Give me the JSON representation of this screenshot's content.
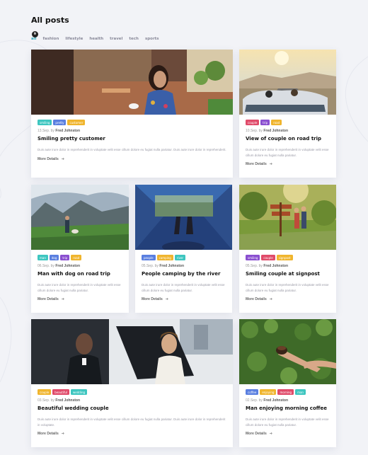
{
  "page": {
    "title": "All posts"
  },
  "filters": [
    {
      "label": "all",
      "active": true,
      "count": "9"
    },
    {
      "label": "fashion"
    },
    {
      "label": "lifestyle"
    },
    {
      "label": "health"
    },
    {
      "label": "travel"
    },
    {
      "label": "tech"
    },
    {
      "label": "sports"
    }
  ],
  "tag_colors": {
    "smiling": "#3ec6c0",
    "pretty": "#5a7fe0",
    "customer": "#f0b52e",
    "couple": "#e04b6a",
    "trip": "#8a4fd0",
    "road": "#f0b52e",
    "man": "#3ec6c0",
    "dog": "#5a7fe0",
    "people": "#5a7fe0",
    "river": "#3ec6c0",
    "signpost": "#f0b52e",
    "beautiful": "#e04b6a",
    "wedding": "#3ec6c0",
    "coffee": "#5a7fe0",
    "enjoying": "#f0b52e",
    "morning": "#e04b6a",
    "man2": "#3ec6c0"
  },
  "cards": [
    {
      "id": "smiling-customer",
      "tags": [
        {
          "label": "smiling",
          "color": "#3ec6c0"
        },
        {
          "label": "pretty",
          "color": "#5a7fe0"
        },
        {
          "label": "customer",
          "color": "#f0b52e"
        }
      ],
      "date": "13.Sep.",
      "by": "by",
      "author": "Fred Johnston",
      "title": "Smiling pretty customer",
      "excerpt": "Duis aute irure dolor in reprehenderit in voluptate velit esse cillum dolore eu fugiat nulla pariatur. Duis aute irure dolor in reprehenderit.",
      "more": "More Details"
    },
    {
      "id": "couple-road-trip",
      "tags": [
        {
          "label": "couple",
          "color": "#e04b6a"
        },
        {
          "label": "trip",
          "color": "#8a4fd0"
        },
        {
          "label": "road",
          "color": "#f0b52e"
        }
      ],
      "date": "10.Sep.",
      "by": "by",
      "author": "Fred Johnston",
      "title": "View of couple on road trip",
      "excerpt": "Duis aute irure dolor in reprehenderit in voluptate velit esse cillum dolore eu fugiat nulla pariatur.",
      "more": "More Details"
    },
    {
      "id": "man-dog-road-trip",
      "tags": [
        {
          "label": "man",
          "color": "#3ec6c0"
        },
        {
          "label": "dog",
          "color": "#5a7fe0"
        },
        {
          "label": "trip",
          "color": "#8a4fd0"
        },
        {
          "label": "road",
          "color": "#f0b52e"
        }
      ],
      "date": "06.Sep.",
      "by": "by",
      "author": "Fred Johnston",
      "title": "Man with dog on road trip",
      "excerpt": "Duis aute irure dolor in reprehenderit in voluptate velit esse cillum dolore eu fugiat nulla pariatur.",
      "more": "More Details"
    },
    {
      "id": "people-camping",
      "tags": [
        {
          "label": "people",
          "color": "#5a7fe0"
        },
        {
          "label": "camping",
          "color": "#f0b52e"
        },
        {
          "label": "river",
          "color": "#3ec6c0"
        }
      ],
      "date": "05.Sep.",
      "by": "by",
      "author": "Fred Johnston",
      "title": "People camping by the river",
      "excerpt": "Duis aute irure dolor in reprehenderit in voluptate velit esse cillum dolore eu fugiat nulla pariatur.",
      "more": "More Details"
    },
    {
      "id": "smiling-couple-signpost",
      "tags": [
        {
          "label": "smiling",
          "color": "#8a4fd0"
        },
        {
          "label": "couple",
          "color": "#e04b6a"
        },
        {
          "label": "signpost",
          "color": "#f0b52e"
        }
      ],
      "date": "05.Sep.",
      "by": "by",
      "author": "Fred Johnston",
      "title": "Smiling couple at signpost",
      "excerpt": "Duis aute irure dolor in reprehenderit in voluptate velit esse cillum dolore eu fugiat nulla pariatur.",
      "more": "More Details"
    },
    {
      "id": "beautiful-wedding-couple",
      "tags": [
        {
          "label": "couple",
          "color": "#f0b52e"
        },
        {
          "label": "beautiful",
          "color": "#e04b6a"
        },
        {
          "label": "wedding",
          "color": "#3ec6c0"
        }
      ],
      "date": "03.Sep.",
      "by": "by",
      "author": "Fred Johnston",
      "title": "Beautiful wedding couple",
      "excerpt": "Duis aute irure dolor in reprehenderit in voluptate velit esse cillum dolore eu fugiat nulla pariatur. Duis aute irure dolor in reprehenderit in voluptate.",
      "more": "More Details"
    },
    {
      "id": "man-morning-coffee",
      "tags": [
        {
          "label": "coffee",
          "color": "#5a7fe0"
        },
        {
          "label": "enjoying",
          "color": "#f0b52e"
        },
        {
          "label": "morning",
          "color": "#e04b6a"
        },
        {
          "label": "man",
          "color": "#3ec6c0"
        }
      ],
      "date": "02.Sep.",
      "by": "by",
      "author": "Fred Johnston",
      "title": "Man enjoying morning coffee",
      "excerpt": "Duis aute irure dolor in reprehenderit in voluptate velit esse cillum dolore eu fugiat nulla pariatur.",
      "more": "More Details"
    }
  ]
}
